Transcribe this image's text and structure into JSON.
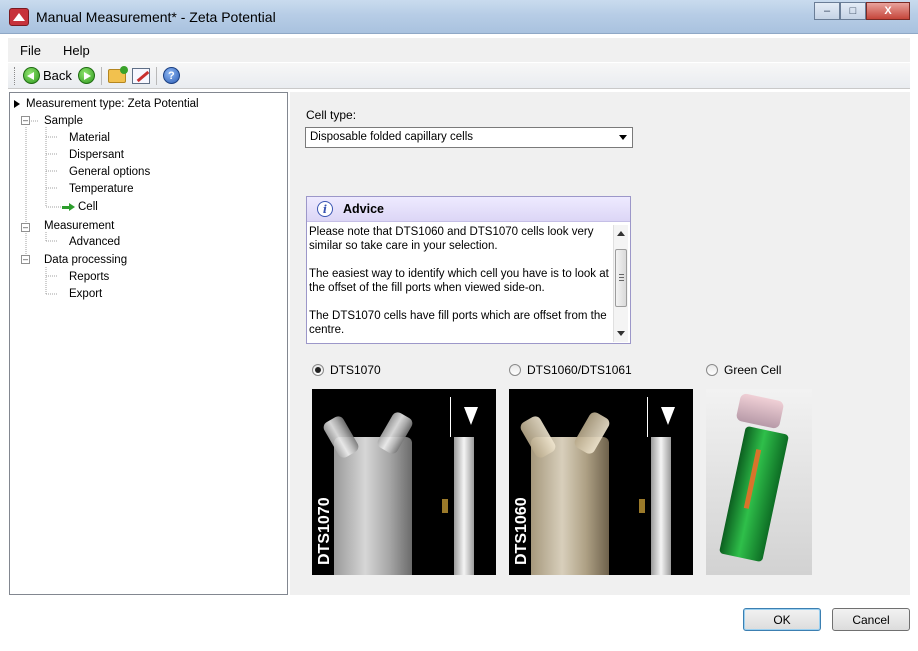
{
  "window": {
    "title": "Manual Measurement* - Zeta Potential",
    "controls": {
      "minimize": "–",
      "maximize": "□",
      "close": "X"
    }
  },
  "menu": {
    "items": [
      "File",
      "Help"
    ]
  },
  "toolbar": {
    "back_label": "Back",
    "icons": [
      "back-arrow-icon",
      "forward-arrow-icon",
      "open-folder-icon",
      "edit-icon",
      "help-icon"
    ]
  },
  "tree": {
    "root": "Measurement type: Zeta Potential",
    "sample": "Sample",
    "sample_children": [
      "Material",
      "Dispersant",
      "General options",
      "Temperature",
      "Cell"
    ],
    "measurement": "Measurement",
    "measurement_children": [
      "Advanced"
    ],
    "data_processing": "Data processing",
    "data_processing_children": [
      "Reports",
      "Export"
    ],
    "selected": "Cell"
  },
  "cell": {
    "label": "Cell type:",
    "selected_value": "Disposable folded capillary cells"
  },
  "advice": {
    "title": "Advice",
    "paragraphs": [
      "Please note that DTS1060 and DTS1070 cells look very similar so take care in your selection.",
      "The easiest way to identify which cell you have is to look at the offset of the fill ports when viewed side-on.",
      "The DTS1070 cells have fill ports which are offset from the centre."
    ]
  },
  "options": [
    {
      "label": "DTS1070",
      "checked": true,
      "photo_text": "DTS1070"
    },
    {
      "label": "DTS1060/DTS1061",
      "checked": false,
      "photo_text": "DTS1060"
    },
    {
      "label": "Green Cell",
      "checked": false
    }
  ],
  "buttons": {
    "ok": "OK",
    "cancel": "Cancel"
  }
}
